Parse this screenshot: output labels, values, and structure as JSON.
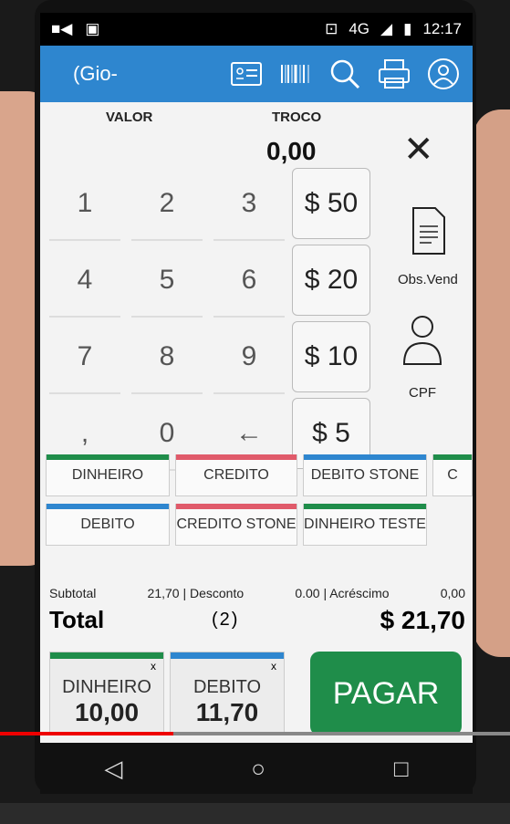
{
  "status": {
    "sim": "4G",
    "time": "12:17"
  },
  "appbar": {
    "title": "(Gio-",
    "icons": [
      "id-card-icon",
      "barcode-icon",
      "search-icon",
      "printer-icon",
      "user-icon"
    ]
  },
  "header": {
    "valor_label": "VALOR",
    "troco_label": "TROCO",
    "troco_value": "0,00"
  },
  "keypad": [
    "1",
    "2",
    "3",
    "4",
    "5",
    "6",
    "7",
    "8",
    "9",
    ",",
    "0",
    "←"
  ],
  "money_buttons": [
    "$ 50",
    "$ 20",
    "$ 10",
    "$ 5"
  ],
  "side": {
    "obs": "Obs.Vend",
    "cpf": "CPF"
  },
  "payment_methods_row1": [
    {
      "label": "DINHEIRO",
      "color": "#1f8d4a"
    },
    {
      "label": "CREDITO",
      "color": "#e05a6a"
    },
    {
      "label": "DEBITO STONE",
      "color": "#2e86cf"
    },
    {
      "label": "C",
      "color": "#1f8d4a"
    }
  ],
  "payment_methods_row2": [
    {
      "label": "DEBITO",
      "color": "#2e86cf"
    },
    {
      "label": "CREDITO STONE",
      "color": "#e05a6a"
    },
    {
      "label": "DINHEIRO TESTE",
      "color": "#1f8d4a"
    }
  ],
  "totals": {
    "subtotal_label": "Subtotal",
    "subtotal_value": "21,70 | Desconto",
    "desconto_value": "0.00 | Acréscimo",
    "acrescimo_value": "0,00",
    "total_label": "Total",
    "count": "(2)",
    "total_value": "$  21,70"
  },
  "tenders": [
    {
      "name": "DINHEIRO",
      "amount": "10,00",
      "color": "#1f8d4a",
      "x": "x"
    },
    {
      "name": "DEBITO",
      "amount": "11,70",
      "color": "#2e86cf",
      "x": "x"
    }
  ],
  "pay_button": "PAGAR",
  "nav": {
    "back": "◁",
    "home": "○",
    "recent": "□"
  },
  "video_progress": 0.34
}
